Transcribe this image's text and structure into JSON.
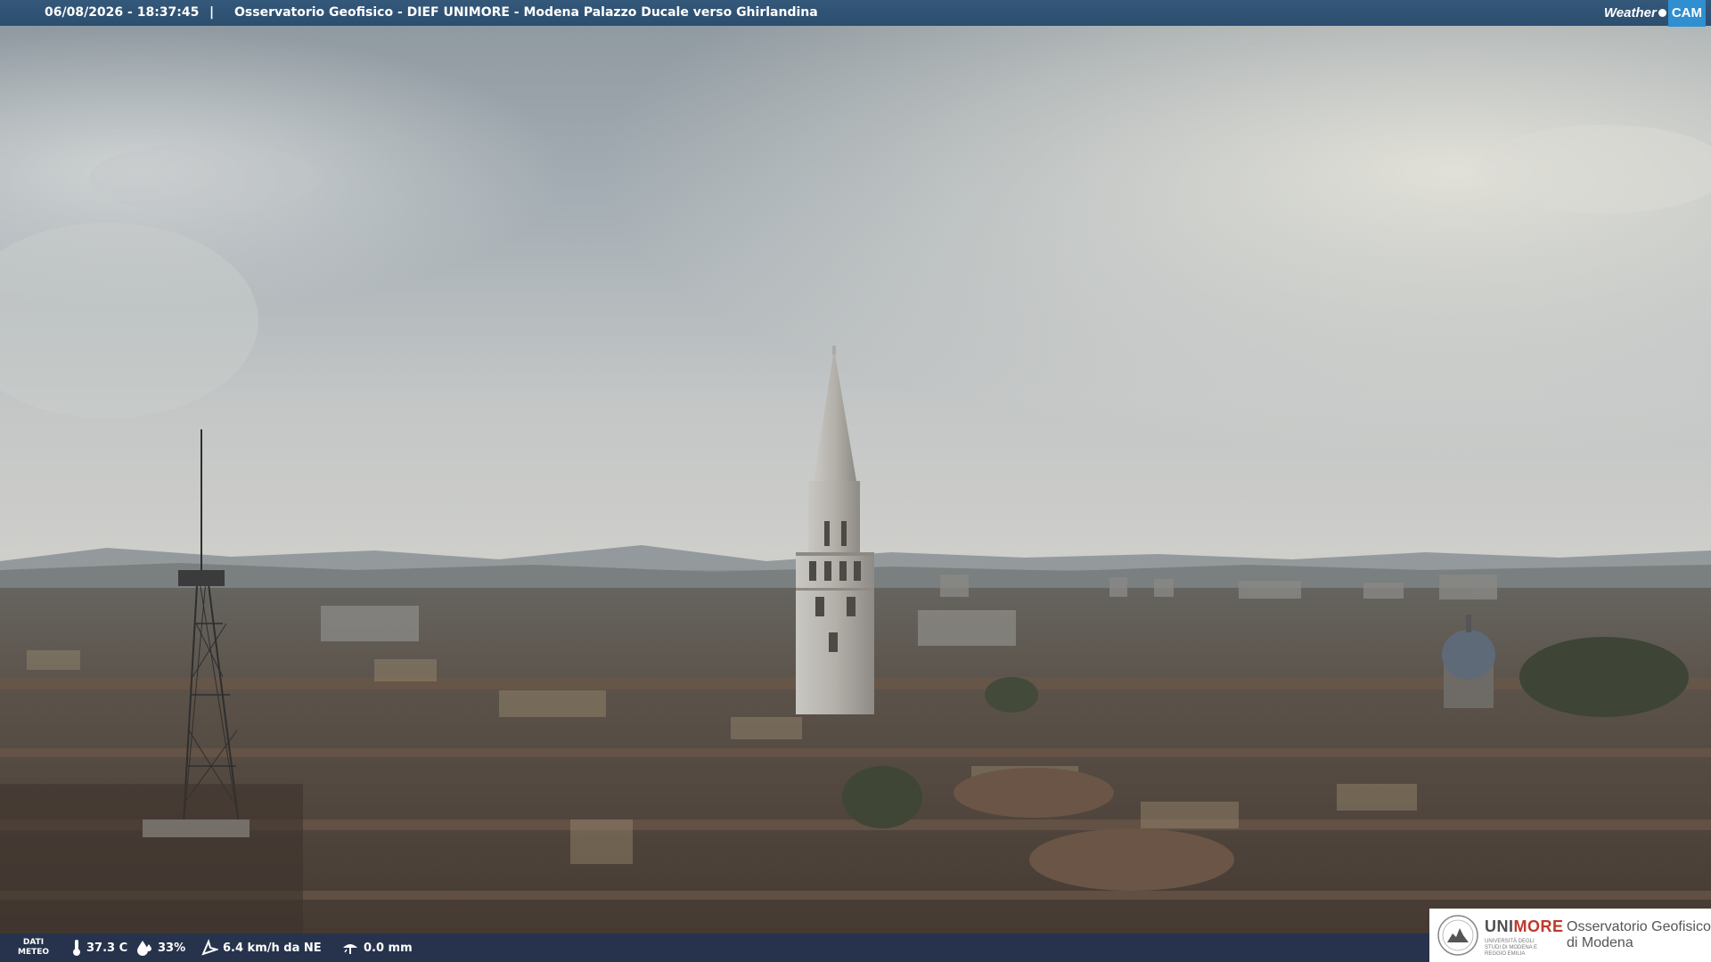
{
  "header": {
    "timestamp": "06/08/2026 - 18:37:45",
    "separator": "|",
    "title": "Osservatorio Geofisico - DIEF UNIMORE - Modena Palazzo Ducale verso Ghirlandina",
    "brand_weather": "Weather",
    "brand_cam": "CAM"
  },
  "meteo": {
    "label_line1": "DATI",
    "label_line2": "METEO",
    "temperature": "37.3 C",
    "humidity": "33%",
    "wind": "6.4 km/h da NE",
    "rain": "0.0 mm",
    "icons": [
      "thermometer-icon",
      "humidity-drop-icon",
      "wind-icon",
      "rain-gauge-icon"
    ]
  },
  "logo": {
    "uni_part1": "UNI",
    "uni_part2": "MORE",
    "university_subtitle": "UNIVERSITÀ DEGLI STUDI DI MODENA E REGGIO EMILIA",
    "observatory_line1": "Osservatorio Geofisico",
    "observatory_line2": "di Modena"
  },
  "colors": {
    "header_bg": "#2f5275",
    "unimore_red": "#c0392b",
    "sky": "#a9b4ba",
    "roofs": "#5a4a3e"
  }
}
